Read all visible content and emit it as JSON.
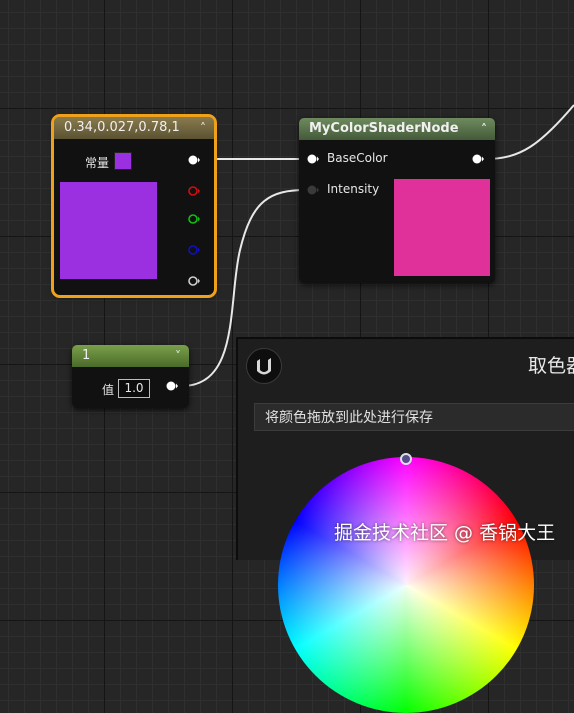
{
  "colors": {
    "constant_color": "#9b30e0",
    "shader_preview": "#e0309a",
    "const_outline": "#f0a11b",
    "pin_white": "#ffffff",
    "pin_red": "#d01010",
    "pin_green": "#10c010",
    "pin_blue": "#1010c0"
  },
  "constant_node": {
    "title": "0.34,0.027,0.78,1",
    "label": "常量",
    "collapse_icon": "chevron-up-icon",
    "output_pins": [
      "white",
      "red",
      "green",
      "blue",
      "alpha"
    ]
  },
  "shader_node": {
    "title": "MyColorShaderNode",
    "collapse_icon": "chevron-up-icon",
    "inputs": [
      "BaseColor",
      "Intensity"
    ]
  },
  "scalar_node": {
    "title": "1",
    "value_label": "值",
    "value": "1.0",
    "collapse_icon": "chevron-down-icon"
  },
  "color_picker": {
    "title": "取色器",
    "save_bar": "将颜色拖放到此处进行保存",
    "logo_icon": "unreal-logo-icon"
  },
  "watermark": "掘金技术社区 @ 香锅大王"
}
